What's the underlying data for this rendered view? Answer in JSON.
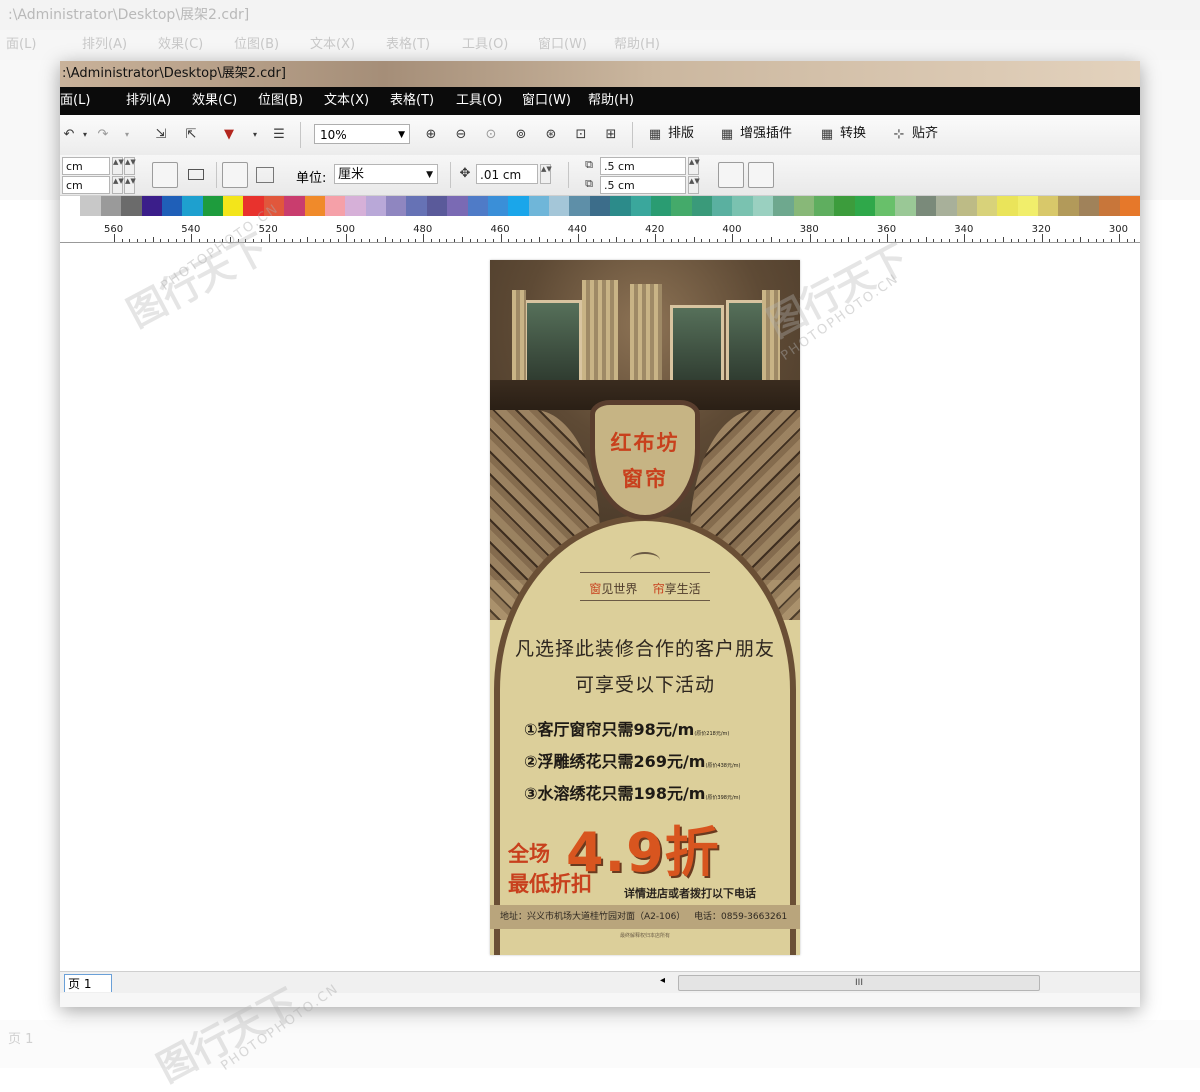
{
  "background_window": {
    "title": ":\\Administrator\\Desktop\\展架2.cdr]",
    "menu": [
      "面(L)",
      "排列(A)",
      "效果(C)",
      "位图(B)",
      "文本(X)",
      "表格(T)",
      "工具(O)",
      "窗口(W)",
      "帮助(H)"
    ],
    "page_tab": "页 1"
  },
  "window": {
    "title": ":\\Administrator\\Desktop\\展架2.cdr]",
    "menu": [
      "面(L)",
      "排列(A)",
      "效果(C)",
      "位图(B)",
      "文本(X)",
      "表格(T)",
      "工具(O)",
      "窗口(W)",
      "帮助(H)"
    ]
  },
  "toolbar": {
    "zoom_value": "10%",
    "buttons": [
      "排版",
      "增强插件",
      "转换",
      "贴齐"
    ]
  },
  "property_bar": {
    "width_unit": "cm",
    "height_unit": "cm",
    "unit_label": "单位:",
    "unit_value": "厘米",
    "nudge_value": ".01 cm",
    "dup_x": ".5 cm",
    "dup_y": ".5 cm"
  },
  "palette_colors": [
    "#ffffff",
    "#c8c8c8",
    "#9a9a9a",
    "#6b6b6b",
    "#3b1e8a",
    "#1f5fb8",
    "#1ea0cf",
    "#1e9c3d",
    "#f3e51a",
    "#e8322d",
    "#e1573c",
    "#c93d6e",
    "#f08a2a",
    "#f5a0a8",
    "#d6b0d8",
    "#b9a8d8",
    "#8f86c0",
    "#6672b5",
    "#5a5a9a",
    "#7a6ab4",
    "#4f7bc7",
    "#3a8fd8",
    "#1aa6ea",
    "#6fb6d9",
    "#a4c6d8",
    "#5e8fa8",
    "#3c6d8a",
    "#2c8b8a",
    "#3aa79c",
    "#2a9c72",
    "#44aa6a",
    "#3a9a7a",
    "#5ab0a0",
    "#7ac2b0",
    "#9ad0c0",
    "#6ea88e",
    "#88b878",
    "#5fae5f",
    "#3c9c3c",
    "#2fa84a",
    "#68c06a",
    "#9ac896",
    "#7a8a7a",
    "#a8b09a",
    "#bdbb86",
    "#d8d27a",
    "#eae45a",
    "#f1ee6b",
    "#d8c86a",
    "#b29a5a",
    "#a0825a",
    "#c8763a",
    "#e6782a"
  ],
  "ruler_ticks": [
    "560",
    "540",
    "520",
    "500",
    "480",
    "460",
    "440",
    "420",
    "400",
    "380",
    "360",
    "340",
    "320",
    "300"
  ],
  "poster": {
    "brand_line1": "红布坊",
    "brand_line2": "窗帘",
    "slogan_red1": "窗",
    "slogan_text1": "见世界",
    "slogan_red2": "帘",
    "slogan_text2": "享生活",
    "headline1": "凡选择此装修合作的客户朋友",
    "headline2": "可享受以下活动",
    "promos": [
      {
        "text": "①客厅窗帘只需98元/m",
        "note": "(原价218元/m)"
      },
      {
        "text": "②浮雕绣花只需269元/m",
        "note": "(原价438元/m)"
      },
      {
        "text": "③水溶绣花只需198元/m",
        "note": "(原价398元/m)"
      }
    ],
    "big_line1": "全场",
    "big_line2": "最低折扣",
    "discount": "4.9折",
    "contact_note": "详情进店或者拨打以下电话",
    "address": "地址：兴义市机场大道桂竹园对面（A2-106）",
    "phone": "电话：0859-3663261",
    "footnote": "最终解释权归本店所有"
  },
  "status": {
    "page_tab": "页 1",
    "scroll_grip": "III"
  },
  "watermarks": {
    "brand": "图行天下",
    "site": "PHOTOPHOTO.CN"
  }
}
